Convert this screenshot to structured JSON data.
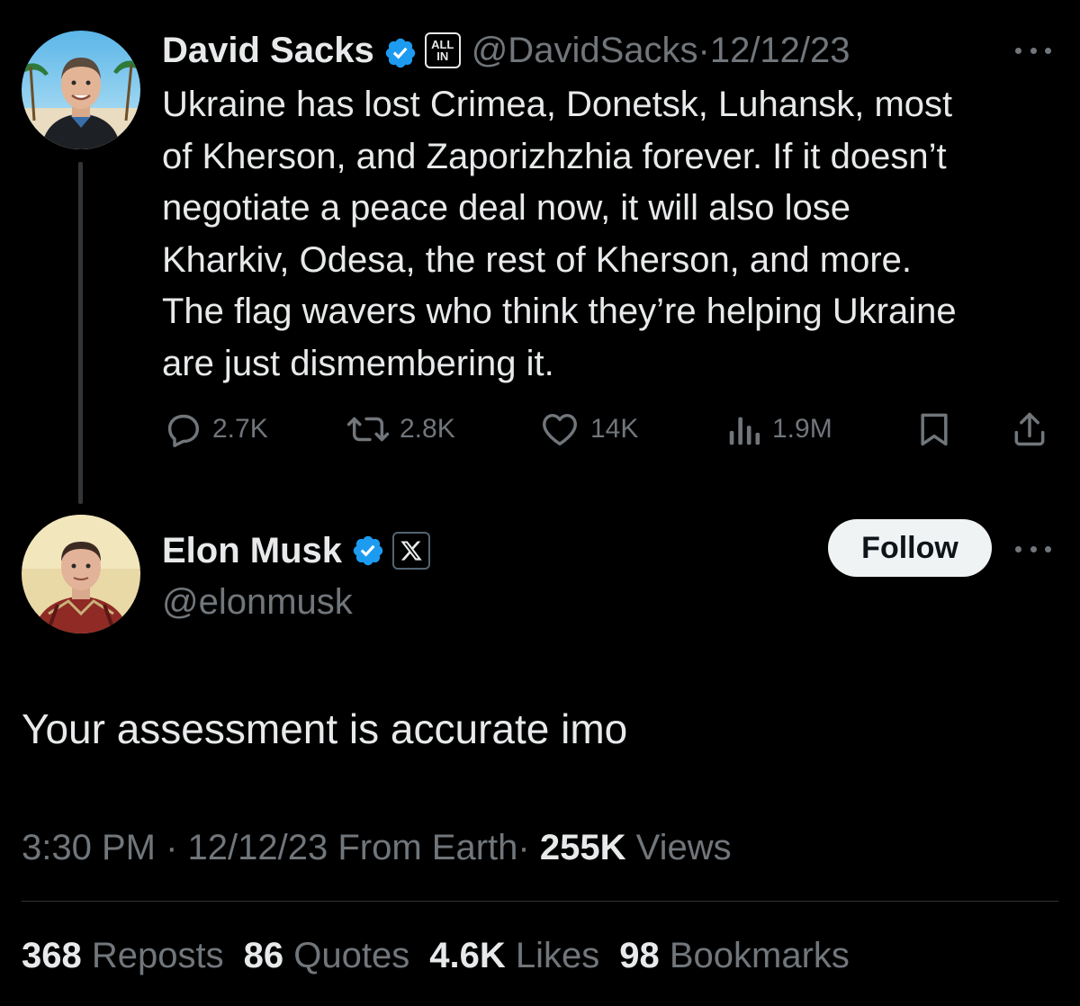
{
  "parent_tweet": {
    "author_name": "David Sacks",
    "affiliation_badge": "ALL IN",
    "affiliation_badge_line1": "ALL",
    "affiliation_badge_line2": "IN",
    "handle": "@DavidSacks",
    "separator": "·",
    "date": "12/12/23",
    "text": "Ukraine has lost Crimea, Donetsk, Luhansk, most of Kherson, and Zaporizhzhia forever. If it doesn’t negotiate a peace deal now, it will also lose Kharkiv, Odesa, the rest of Kherson, and more. The flag wavers who think they’re helping Ukraine are just dismembering it.",
    "text_lines": [
      "Ukraine has lost Crimea, Donetsk, Luhansk, most",
      "of Kherson, and Zaporizhzhia forever. If it doesn’t",
      "negotiate a peace deal now, it will also lose",
      "Kharkiv, Odesa, the rest of Kherson, and more.",
      "The flag wavers who think they’re helping Ukraine",
      "are just dismembering it."
    ],
    "actions": {
      "replies": "2.7K",
      "reposts": "2.8K",
      "likes": "14K",
      "views": "1.9M"
    },
    "icons": {
      "reply": "reply-icon",
      "repost": "repost-icon",
      "like": "heart-icon",
      "views": "views-icon",
      "bookmark": "bookmark-icon",
      "share": "share-icon",
      "more": "more-icon",
      "verified": "verified-badge-icon"
    }
  },
  "main_tweet": {
    "author_name": "Elon Musk",
    "handle": "@elonmusk",
    "affiliation_badge": "X",
    "follow_label": "Follow",
    "text": "Your assessment is accurate imo",
    "time": "3:30 PM",
    "separator": "·",
    "date": "12/12/23",
    "source": "From Earth",
    "views_count": "255K",
    "views_label": "Views",
    "stats": {
      "reposts_count": "368",
      "reposts_label": "Reposts",
      "quotes_count": "86",
      "quotes_label": "Quotes",
      "likes_count": "4.6K",
      "likes_label": "Likes",
      "bookmarks_count": "98",
      "bookmarks_label": "Bookmarks"
    }
  },
  "colors": {
    "background": "#000000",
    "primary_text": "#e7e9ea",
    "secondary_text": "#71767b",
    "verified_blue": "#1d9bf0",
    "follow_button_bg": "#eff3f4",
    "divider": "#2f3336"
  }
}
